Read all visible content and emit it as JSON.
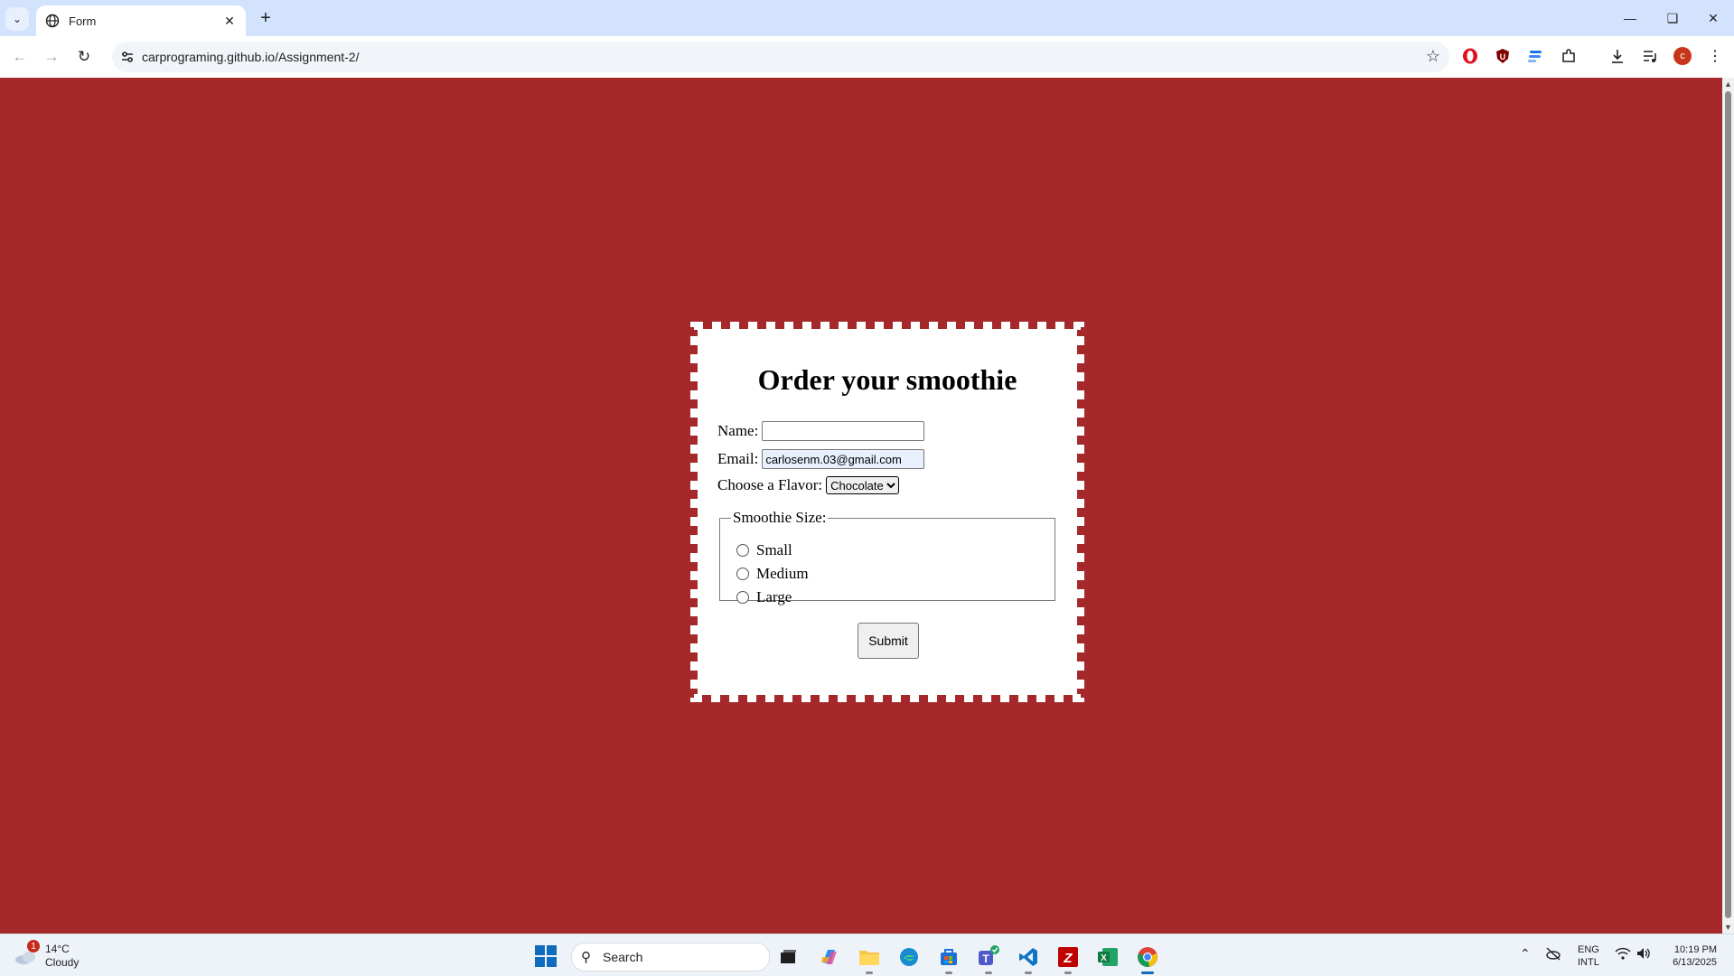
{
  "browser": {
    "tab_title": "Form",
    "url": "carprograming.github.io/Assignment-2/",
    "profile_initial": "c"
  },
  "form": {
    "heading": "Order your smoothie",
    "name_label": "Name:",
    "name_value": "",
    "email_label": "Email:",
    "email_value": "carlosenm.03@gmail.com",
    "flavor_label": "Choose a Flavor:",
    "flavor_selected": "Chocolate",
    "size_legend": "Smoothie Size:",
    "sizes": [
      "Small",
      "Medium",
      "Large"
    ],
    "submit_label": "Submit"
  },
  "taskbar": {
    "weather_badge": "1",
    "temperature": "14°C",
    "condition": "Cloudy",
    "search_label": "Search",
    "lang_1": "ENG",
    "lang_2": "INTL",
    "time": "10:19 PM",
    "date": "6/13/2025"
  },
  "colors": {
    "page_background": "#a5292a",
    "card_background": "#ffffff",
    "tabbar": "#d3e3fd"
  }
}
